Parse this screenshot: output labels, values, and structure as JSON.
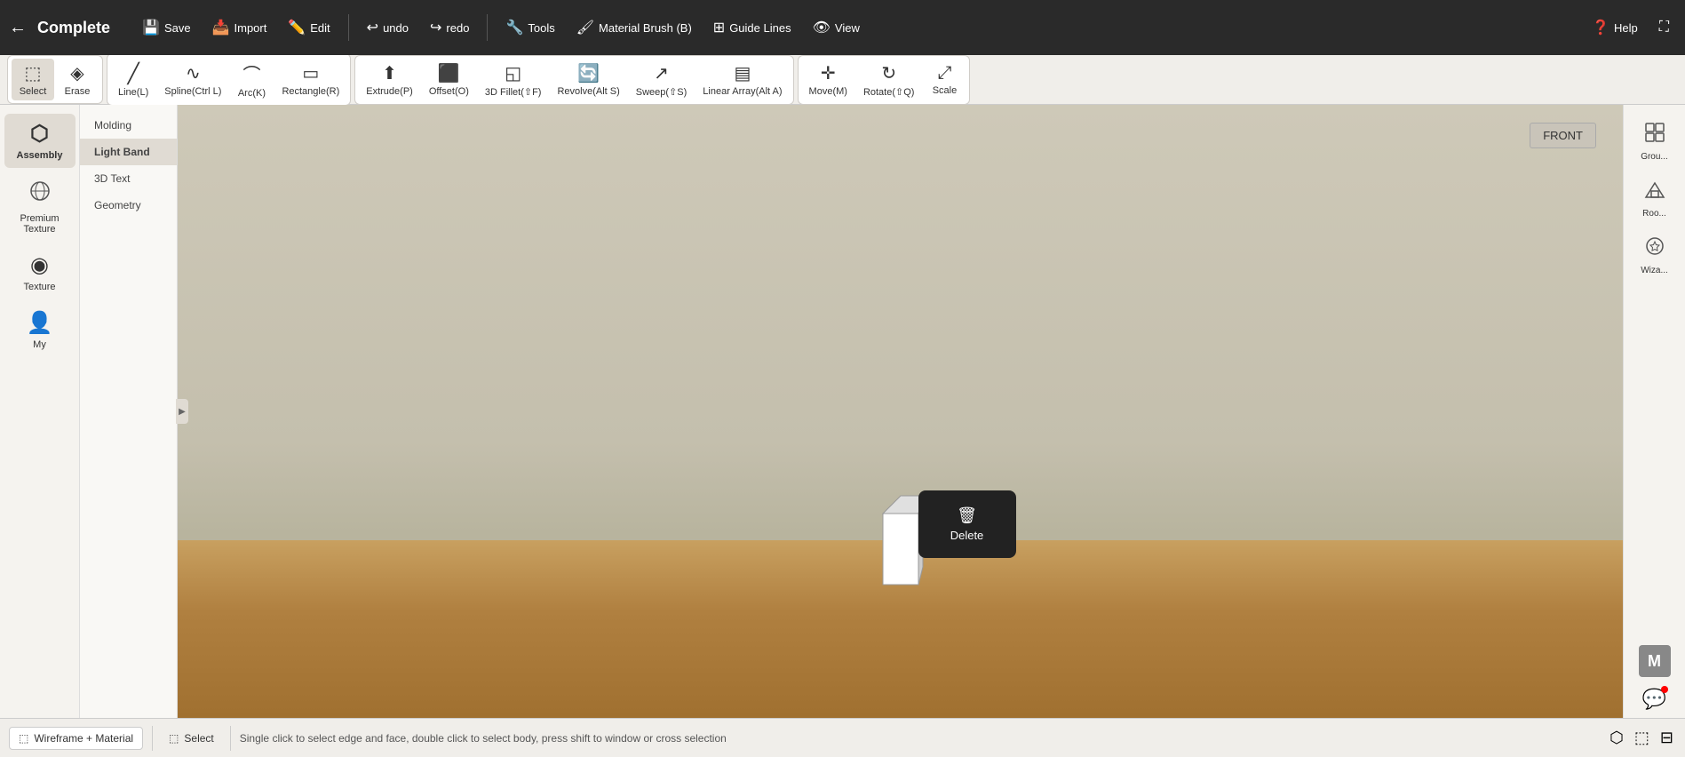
{
  "topbar": {
    "back_icon": "←",
    "title": "Complete",
    "buttons": [
      {
        "label": "Save",
        "icon": "💾",
        "key": "save"
      },
      {
        "label": "Import",
        "icon": "📥",
        "key": "import"
      },
      {
        "label": "Edit",
        "icon": "✏️",
        "key": "edit"
      },
      {
        "label": "undo",
        "icon": "↩",
        "key": "undo"
      },
      {
        "label": "redo",
        "icon": "↪",
        "key": "redo"
      },
      {
        "label": "Tools",
        "icon": "🔧",
        "key": "tools"
      },
      {
        "label": "Material Brush (B)",
        "icon": "🖌",
        "key": "material_brush"
      },
      {
        "label": "Guide Lines",
        "icon": "⊞",
        "key": "guide_lines"
      },
      {
        "label": "View",
        "icon": "👁",
        "key": "view"
      }
    ],
    "right_buttons": [
      {
        "label": "Help",
        "icon": "❓",
        "key": "help"
      },
      {
        "label": "fullscreen",
        "icon": "⛶",
        "key": "fullscreen"
      }
    ]
  },
  "toolbar": {
    "groups": [
      {
        "id": "select-erase",
        "tools": [
          {
            "label": "Select",
            "icon": "⬚",
            "key": "select",
            "active": true
          },
          {
            "label": "Erase",
            "icon": "◈",
            "key": "erase"
          }
        ]
      },
      {
        "id": "draw",
        "tools": [
          {
            "label": "Line(L)",
            "icon": "╱",
            "key": "line"
          },
          {
            "label": "Spline(Ctrl L)",
            "icon": "∿",
            "key": "spline"
          },
          {
            "label": "Arc(K)",
            "icon": "⌒",
            "key": "arc"
          },
          {
            "label": "Rectangle(R)",
            "icon": "▭",
            "key": "rectangle"
          }
        ]
      },
      {
        "id": "solid",
        "tools": [
          {
            "label": "Extrude(P)",
            "icon": "⬆",
            "key": "extrude"
          },
          {
            "label": "Offset(O)",
            "icon": "⬛",
            "key": "offset"
          },
          {
            "label": "3D Fillet(⇧F)",
            "icon": "◱",
            "key": "fillet3d"
          },
          {
            "label": "Revolve(Alt S)",
            "icon": "🔄",
            "key": "revolve"
          },
          {
            "label": "Sweep(⇧S)",
            "icon": "↗",
            "key": "sweep"
          },
          {
            "label": "Linear Array(Alt A)",
            "icon": "▤",
            "key": "linear_array"
          }
        ]
      },
      {
        "id": "transform",
        "tools": [
          {
            "label": "Move(M)",
            "icon": "✛",
            "key": "move"
          },
          {
            "label": "Rotate(⇧Q)",
            "icon": "↻",
            "key": "rotate"
          },
          {
            "label": "Scale",
            "icon": "⤢",
            "key": "scale"
          }
        ]
      }
    ]
  },
  "sidebar": {
    "items": [
      {
        "label": "Assembly",
        "icon": "⬡",
        "key": "assembly",
        "active": true
      },
      {
        "label": "Premium Texture",
        "icon": "◈",
        "key": "premium_texture"
      },
      {
        "label": "Texture",
        "icon": "◉",
        "key": "texture"
      },
      {
        "label": "My",
        "icon": "👤",
        "key": "my"
      }
    ]
  },
  "molding_panel": {
    "title": "Molding",
    "items": [
      {
        "label": "Molding",
        "key": "molding"
      },
      {
        "label": "Light Band",
        "key": "light_band",
        "active": true
      },
      {
        "label": "3D Text",
        "key": "3d_text"
      },
      {
        "label": "Geometry",
        "key": "geometry"
      }
    ]
  },
  "viewport": {
    "label": "FRONT",
    "context_menu": {
      "items": [
        {
          "label": "Delete",
          "icon": "🗑",
          "key": "delete"
        }
      ]
    }
  },
  "right_panel": {
    "items": [
      {
        "label": "Grou...",
        "icon": "⬡",
        "key": "group"
      },
      {
        "label": "Roo...",
        "icon": "⬡",
        "key": "room"
      },
      {
        "label": "Wiza...",
        "icon": "⬡",
        "key": "wizard"
      }
    ],
    "m_badge": "M"
  },
  "bottombar": {
    "mode_label": "Wireframe + Material",
    "mode_icon": "⬚",
    "select_label": "Select",
    "select_icon": "⬚",
    "hint": "Single click to select edge and face, double click to select body, press shift to window or cross selection",
    "right_icons": [
      "⬡",
      "⬚",
      "⊟"
    ]
  }
}
